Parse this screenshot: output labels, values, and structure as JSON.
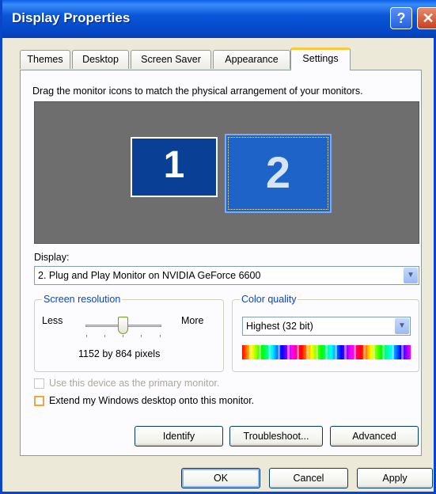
{
  "window": {
    "title": "Display Properties",
    "help_glyph": "?",
    "close_glyph": "✕",
    "title_gradient": "#0A56D8"
  },
  "tabs": [
    {
      "label": "Themes",
      "active": false
    },
    {
      "label": "Desktop",
      "active": false
    },
    {
      "label": "Screen Saver",
      "active": false
    },
    {
      "label": "Appearance",
      "active": false
    },
    {
      "label": "Settings",
      "active": true
    }
  ],
  "settings": {
    "instruction": "Drag the monitor icons to match the physical arrangement of your monitors.",
    "monitors": [
      {
        "number": "1",
        "selected": false
      },
      {
        "number": "2",
        "selected": true
      }
    ],
    "display_label": "Display:",
    "display_value": "2. Plug and Play Monitor on NVIDIA GeForce 6600",
    "screen_resolution": {
      "title": "Screen resolution",
      "less_label": "Less",
      "more_label": "More",
      "value_text": "1152 by 864 pixels",
      "slider_level": 0.5
    },
    "color_quality": {
      "title": "Color quality",
      "selected": "Highest (32 bit)"
    },
    "primary_monitor": {
      "label": "Use this device as the primary monitor.",
      "checked": false,
      "enabled": false
    },
    "extend_desktop": {
      "label": "Extend my Windows desktop onto this monitor.",
      "checked": false,
      "enabled": true
    },
    "buttons": {
      "identify": "Identify",
      "troubleshoot": "Troubleshoot...",
      "advanced": "Advanced"
    }
  },
  "footer": {
    "ok": "OK",
    "cancel": "Cancel",
    "apply": "Apply"
  },
  "colors": {
    "titlebar": "#0A56D8",
    "face": "#ECE9D8",
    "group_title": "#0046D5",
    "active_tab_accent": "#FFC83C"
  },
  "icons": {
    "help": "help-icon",
    "close": "close-icon",
    "dropdown": "chevron-down-icon"
  }
}
